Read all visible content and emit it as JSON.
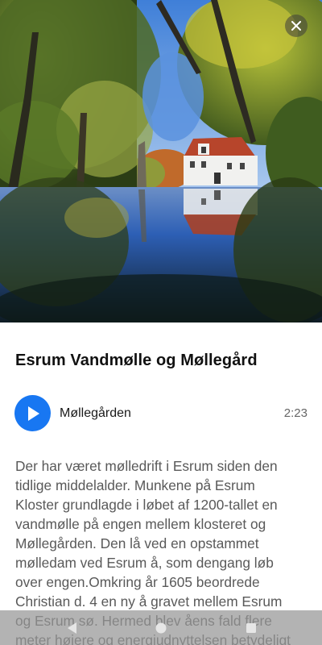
{
  "hero": {
    "image_alt": "Water mill reflected in a forest pond",
    "close_icon": "close-icon"
  },
  "content": {
    "title": "Esrum Vandmølle og Møllegård",
    "audio": {
      "play_icon": "play-icon",
      "track_name": "Møllegården",
      "duration": "2:23",
      "accent_color": "#1877f2"
    },
    "description": "Der har været mølledrift i Esrum siden den tidlige middelalder. Munkene på Esrum Kloster grundlagde i løbet af 1200-tallet en vandmølle på engen mellem klosteret og Møllegården. Den lå ved en opstammet mølledam ved Esrum å, som dengang løb over engen.Omkring år 1605 beordrede Christian d. 4 en ny å gravet mellem Esrum og Esrum sø. Hermed blev åens fald flere meter højere og energiudnyttelsen betydeligt bedre."
  },
  "navbar": {
    "back_icon": "back-triangle-icon",
    "home_icon": "home-circle-icon",
    "recents_icon": "recents-square-icon"
  }
}
